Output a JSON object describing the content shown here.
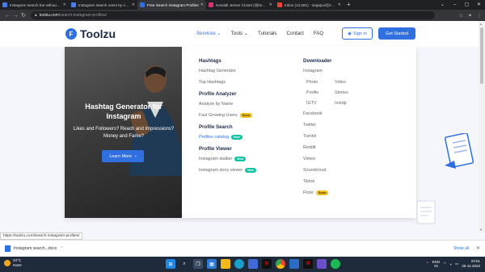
{
  "browser": {
    "tabs": [
      {
        "label": "Instagram search bar without a...",
        "fav_color": "#4a7cf0",
        "active": false
      },
      {
        "label": "Instagram search users by name...",
        "fav_color": "#4a7cf0",
        "active": false
      },
      {
        "label": "Free Search Instagram Profiles",
        "fav_color": "#2f6fe0",
        "active": true
      },
      {
        "label": "Kendall Jenner Closet (@kendall...",
        "fav_color": "#d6336c",
        "active": false
      },
      {
        "label": "Inbox (12,581) - srajapur@201...",
        "fav_color": "#ea4335",
        "active": false
      }
    ],
    "url_host": "toolzu.com",
    "url_path": "/search-instagram-profiles/"
  },
  "header": {
    "logo_mark": "F",
    "logo_text": "Toolzu",
    "nav": [
      {
        "label": "Services",
        "caret": "⌄",
        "active": true
      },
      {
        "label": "Tools",
        "caret": "⌄",
        "active": false
      },
      {
        "label": "Tutorials",
        "caret": "",
        "active": false
      },
      {
        "label": "Contact",
        "caret": "",
        "active": false
      },
      {
        "label": "FAQ",
        "caret": "",
        "active": false
      }
    ],
    "signin_label": "Sign in",
    "get_started_label": "Get Started"
  },
  "hero": {
    "title": "Hashtag Generator for Instagram",
    "subtitle": "Likes and Followers? Reach and Impressions? Money and Fame?",
    "button_label": "Learn More"
  },
  "menu": {
    "hashtags": {
      "heading": "Hashtags",
      "items": [
        "Hashtag Generator",
        "Top Hashtags"
      ]
    },
    "profile_analyzer": {
      "heading": "Profile Analyzer",
      "items": [
        {
          "label": "Analyze by Name",
          "badge": ""
        },
        {
          "label": "Fast Growing Users",
          "badge": "Soon"
        }
      ]
    },
    "profile_search": {
      "heading": "Profile Search",
      "items": [
        {
          "label": "Profiles catalog",
          "badge": "New"
        }
      ]
    },
    "profile_viewer": {
      "heading": "Profile Viewer",
      "items": [
        {
          "label": "Instagram stalker",
          "badge": "New"
        },
        {
          "label": "Instagram story viewer",
          "badge": "New"
        }
      ]
    },
    "downloader": {
      "heading": "Downloader",
      "instagram_label": "Instagram",
      "instagram_sub": [
        "Photo",
        "Video",
        "Profile",
        "Stories",
        "IGTV",
        "Instdp"
      ],
      "platforms": [
        {
          "label": "Facebook",
          "badge": ""
        },
        {
          "label": "Twitter",
          "badge": ""
        },
        {
          "label": "Tumblr",
          "badge": ""
        },
        {
          "label": "Reddit",
          "badge": ""
        },
        {
          "label": "Vimeo",
          "badge": ""
        },
        {
          "label": "Soundcloud",
          "badge": ""
        },
        {
          "label": "Tiktok",
          "badge": ""
        },
        {
          "label": "Flickr",
          "badge": "Soon"
        }
      ]
    }
  },
  "status_url": "https://toolzu.com/search-instagram-profiles/",
  "downloads": {
    "item_label": "Instagram search...docx",
    "show_all_label": "Show all"
  },
  "taskbar": {
    "weather_temp": "24°C",
    "weather_desc": "Haze",
    "lang": "ENG",
    "lang_sub": "IN",
    "time": "23:51",
    "date": "25-11-2022"
  },
  "colors": {
    "accent": "#2f6fe0",
    "badge_new": "#12c2a0",
    "badge_soon": "#f4c01c"
  }
}
